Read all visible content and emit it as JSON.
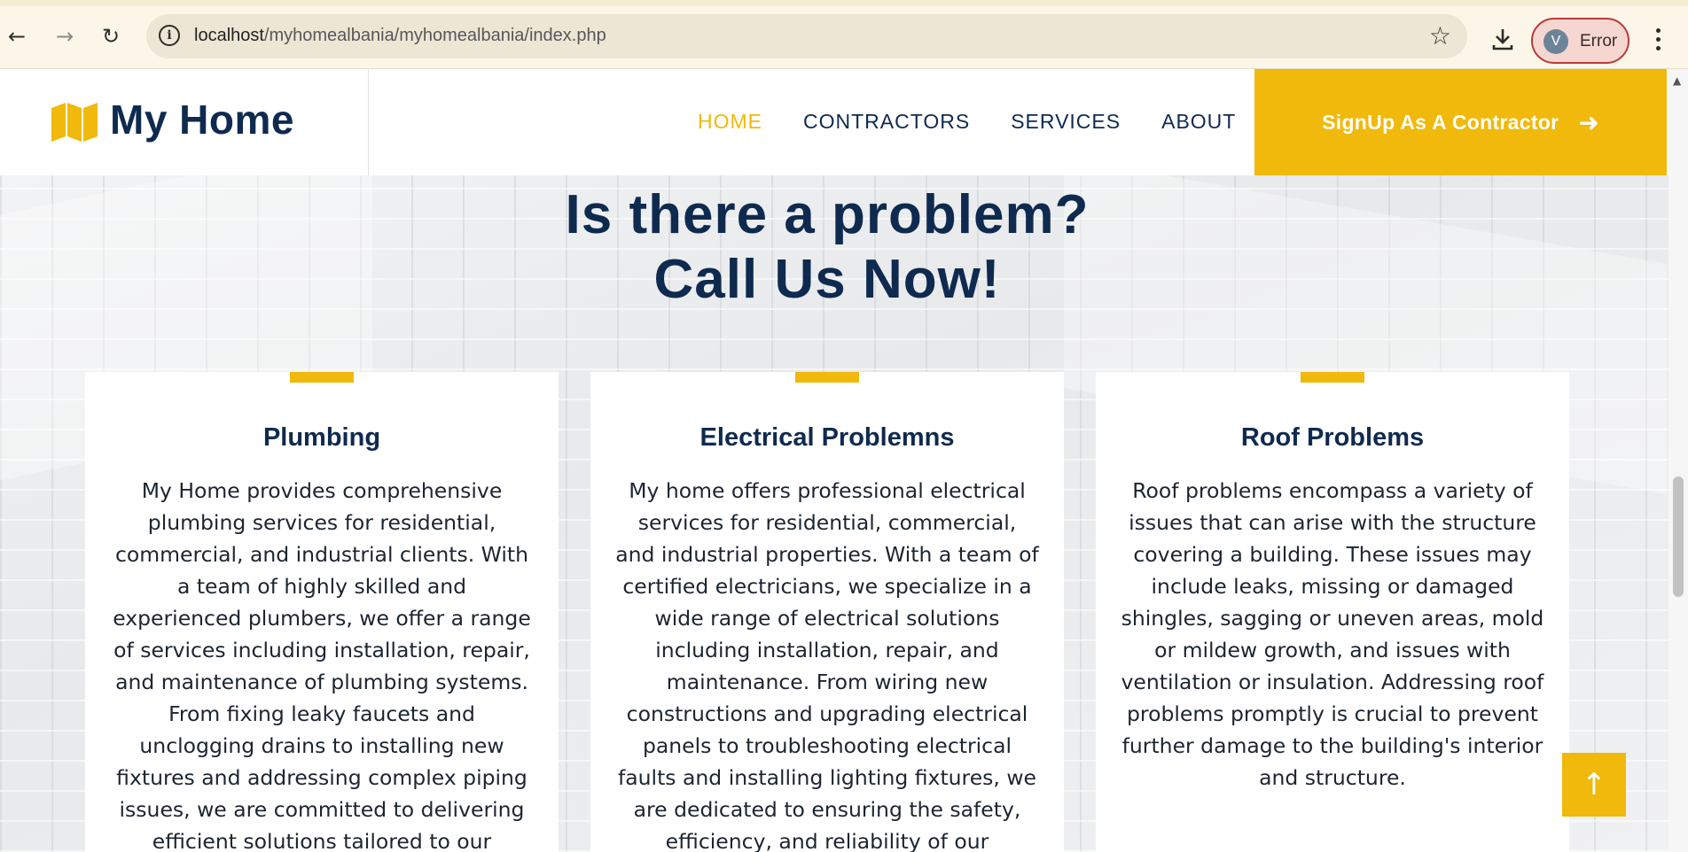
{
  "browser": {
    "url_host": "localhost",
    "url_path": "/myhomealbania/myhomealbania/index.php",
    "profile_initial": "V",
    "profile_status": "Error",
    "icons": [
      "back-arrow-icon",
      "forward-arrow-icon",
      "reload-icon",
      "info-icon",
      "star-icon",
      "download-icon",
      "kebab-menu-icon"
    ]
  },
  "header": {
    "brand_name": "My Home",
    "brand_icon": "map-icon",
    "nav": [
      {
        "label": "HOME",
        "active": true
      },
      {
        "label": "CONTRACTORS",
        "active": false
      },
      {
        "label": "SERVICES",
        "active": false
      },
      {
        "label": "ABOUT",
        "active": false
      }
    ],
    "cta_label": "SignUp As A Contractor",
    "cta_icon": "arrow-right-icon"
  },
  "section": {
    "heading_line1": "Is there a problem?",
    "heading_line2": "Call Us Now!"
  },
  "cards": [
    {
      "title": "Plumbing",
      "body": "My Home provides comprehensive plumbing services for residential, commercial, and industrial clients. With a team of highly skilled and experienced plumbers, we offer a range of services including installation, repair, and maintenance of plumbing systems. From fixing leaky faucets and unclogging drains to installing new fixtures and addressing complex piping issues, we are committed to delivering efficient solutions tailored to our"
    },
    {
      "title": "Electrical Problemns",
      "body": "My home offers professional electrical services for residential, commercial, and industrial properties. With a team of certified electricians, we specialize in a wide range of electrical solutions including installation, repair, and maintenance. From wiring new constructions and upgrading electrical panels to troubleshooting electrical faults and installing lighting fixtures, we are dedicated to ensuring the safety, efficiency, and reliability of our"
    },
    {
      "title": "Roof Problems",
      "body": "Roof problems encompass a variety of issues that can arise with the structure covering a building. These issues may include leaks, missing or damaged shingles, sagging or uneven areas, mold or mildew growth, and issues with ventilation or insulation. Addressing roof problems promptly is crucial to prevent further damage to the building's interior and structure."
    }
  ],
  "back_to_top_icon": "arrow-up-icon",
  "colors": {
    "accent": "#f0b90b",
    "navy": "#0f2a4f"
  }
}
